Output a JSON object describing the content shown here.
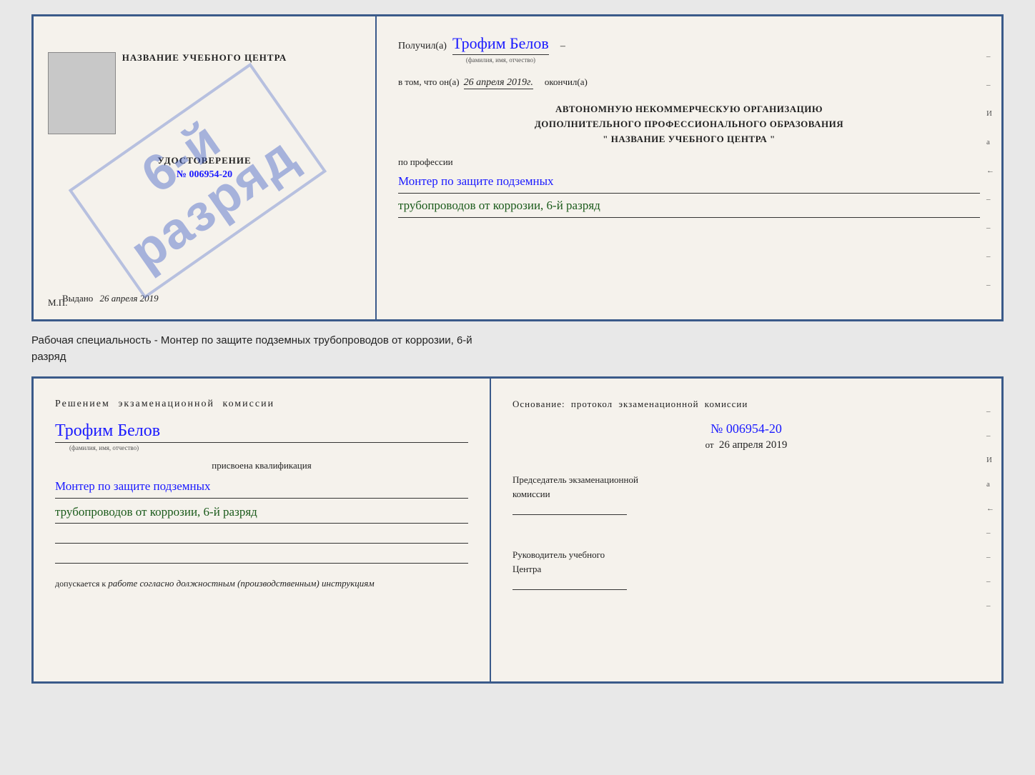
{
  "top_doc": {
    "left": {
      "title": "НАЗВАНИЕ УЧЕБНОГО ЦЕНТРА",
      "stamp_line1": "6-й",
      "stamp_line2": "разряд",
      "udostoverenie_label": "УДОСТОВЕРЕНИЕ",
      "udost_number": "№ 006954-20",
      "vydano_label": "Выдано",
      "vydano_date": "26 апреля 2019",
      "mp_label": "М.П."
    },
    "right": {
      "poluchil_label": "Получил(а)",
      "poluchil_name": "Трофим Белов",
      "fio_label": "(фамилия, имя, отчество)",
      "dash1": "–",
      "vtom_label": "в том, что он(а)",
      "vtom_date": "26 апреля 2019г.",
      "okoncil_label": "окончил(а)",
      "org_line1": "АВТОНОМНУЮ НЕКОММЕРЧЕСКУЮ ОРГАНИЗАЦИЮ",
      "org_line2": "ДОПОЛНИТЕЛЬНОГО ПРОФЕССИОНАЛЬНОГО ОБРАЗОВАНИЯ",
      "org_name": "\" НАЗВАНИЕ УЧЕБНОГО ЦЕНТРА \"",
      "po_professii_label": "по профессии",
      "profession_line1": "Монтер по защите подземных",
      "profession_line2": "трубопроводов от коррозии, 6-й разряд",
      "side_chars": [
        "-",
        "-",
        "И",
        "а",
        "←",
        "-",
        "-",
        "-",
        "-"
      ]
    }
  },
  "separator": {
    "text_line1": "Рабочая специальность - Монтер по защите подземных трубопроводов от коррозии, 6-й",
    "text_line2": "разряд"
  },
  "bottom_doc": {
    "left": {
      "resheniem_text": "Решением  экзаменационной  комиссии",
      "name": "Трофим Белов",
      "fio_label": "(фамилия, имя, отчество)",
      "prisvoena_label": "присвоена квалификация",
      "qual_line1": "Монтер по защите подземных",
      "qual_line2": "трубопроводов от коррозии, 6-й разряд",
      "empty_lines": [
        "",
        ""
      ],
      "dopuskaetsya_label": "допускается к",
      "dopusk_text": "работе согласно должностным (производственным) инструкциям"
    },
    "right": {
      "osnovanie_text": "Основание:  протокол  экзаменационной  комиссии",
      "protocol_number": "№  006954-20",
      "ot_label": "от",
      "ot_date": "26 апреля 2019",
      "predsedatel_line1": "Председатель экзаменационной",
      "predsedatel_line2": "комиссии",
      "rukovoditel_line1": "Руководитель учебного",
      "rukovoditel_line2": "Центра",
      "side_chars": [
        "-",
        "-",
        "И",
        "а",
        "←",
        "-",
        "-",
        "-",
        "-"
      ]
    }
  }
}
